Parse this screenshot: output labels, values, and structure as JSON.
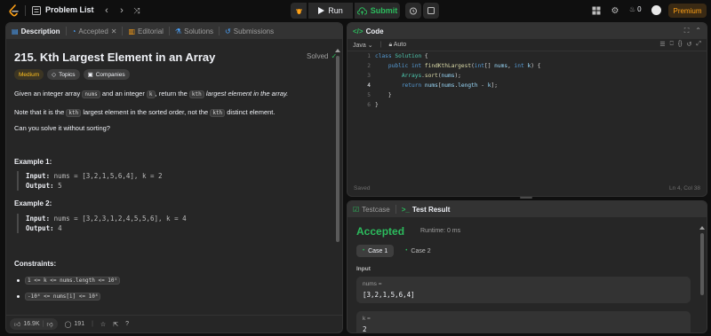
{
  "topbar": {
    "problem_list": "Problem List",
    "run_label": "Run",
    "submit_label": "Submit",
    "streak_count": "0",
    "premium_label": "Premium"
  },
  "left": {
    "tabs": [
      {
        "label": "Description",
        "icon": "description-icon"
      },
      {
        "label": "Accepted",
        "icon": "accepted-icon"
      },
      {
        "label": "Editorial",
        "icon": "editorial-icon"
      },
      {
        "label": "Solutions",
        "icon": "solutions-icon"
      },
      {
        "label": "Submissions",
        "icon": "submissions-icon"
      }
    ],
    "title": "215. Kth Largest Element in an Array",
    "solved_label": "Solved",
    "difficulty": "Medium",
    "topics_label": "Topics",
    "companies_label": "Companies",
    "p1_a": "Given an integer array",
    "p1_code1": "nums",
    "p1_b": "and an integer",
    "p1_code2": "k",
    "p1_c": ", return the",
    "p1_code3": "kth",
    "p1_d": "largest element in the array.",
    "p2_a": "Note that it is the",
    "p2_code1": "kth",
    "p2_b": "largest element in the sorted order, not the",
    "p2_code2": "kth",
    "p2_c": "distinct element.",
    "p3": "Can you solve it without sorting?",
    "ex1_title": "Example 1:",
    "ex1_input_label": "Input:",
    "ex1_input": "nums = [3,2,1,5,6,4], k = 2",
    "ex1_output_label": "Output:",
    "ex1_output": "5",
    "ex2_title": "Example 2:",
    "ex2_input_label": "Input:",
    "ex2_input": "nums = [3,2,3,1,2,4,5,5,6], k = 4",
    "ex2_output_label": "Output:",
    "ex2_output": "4",
    "constraints_title": "Constraints:",
    "c1": "1 <= k <= nums.length <= 10⁵",
    "c2": "-10⁴ <= nums[i] <= 10⁴",
    "likes": "16.9K",
    "comments": "191"
  },
  "code": {
    "tab_label": "Code",
    "language": "Java",
    "mode": "Auto",
    "lines": [
      "1",
      "2",
      "3",
      "4",
      "5",
      "6"
    ],
    "status": "Saved",
    "cursor": "Ln 4, Col 38"
  },
  "result": {
    "testcase_tab": "Testcase",
    "result_tab": "Test Result",
    "verdict": "Accepted",
    "runtime": "Runtime: 0 ms",
    "case1": "Case 1",
    "case2": "Case 2",
    "input_label": "Input",
    "nums_key": "nums =",
    "nums_val": "[3,2,1,5,6,4]",
    "k_key": "k =",
    "k_val": "2"
  },
  "colors": {
    "accent": "#ffa116",
    "success": "#2cbb5d",
    "medium": "#ffc01e",
    "panel": "#262626",
    "background": "#0f0f0f"
  }
}
